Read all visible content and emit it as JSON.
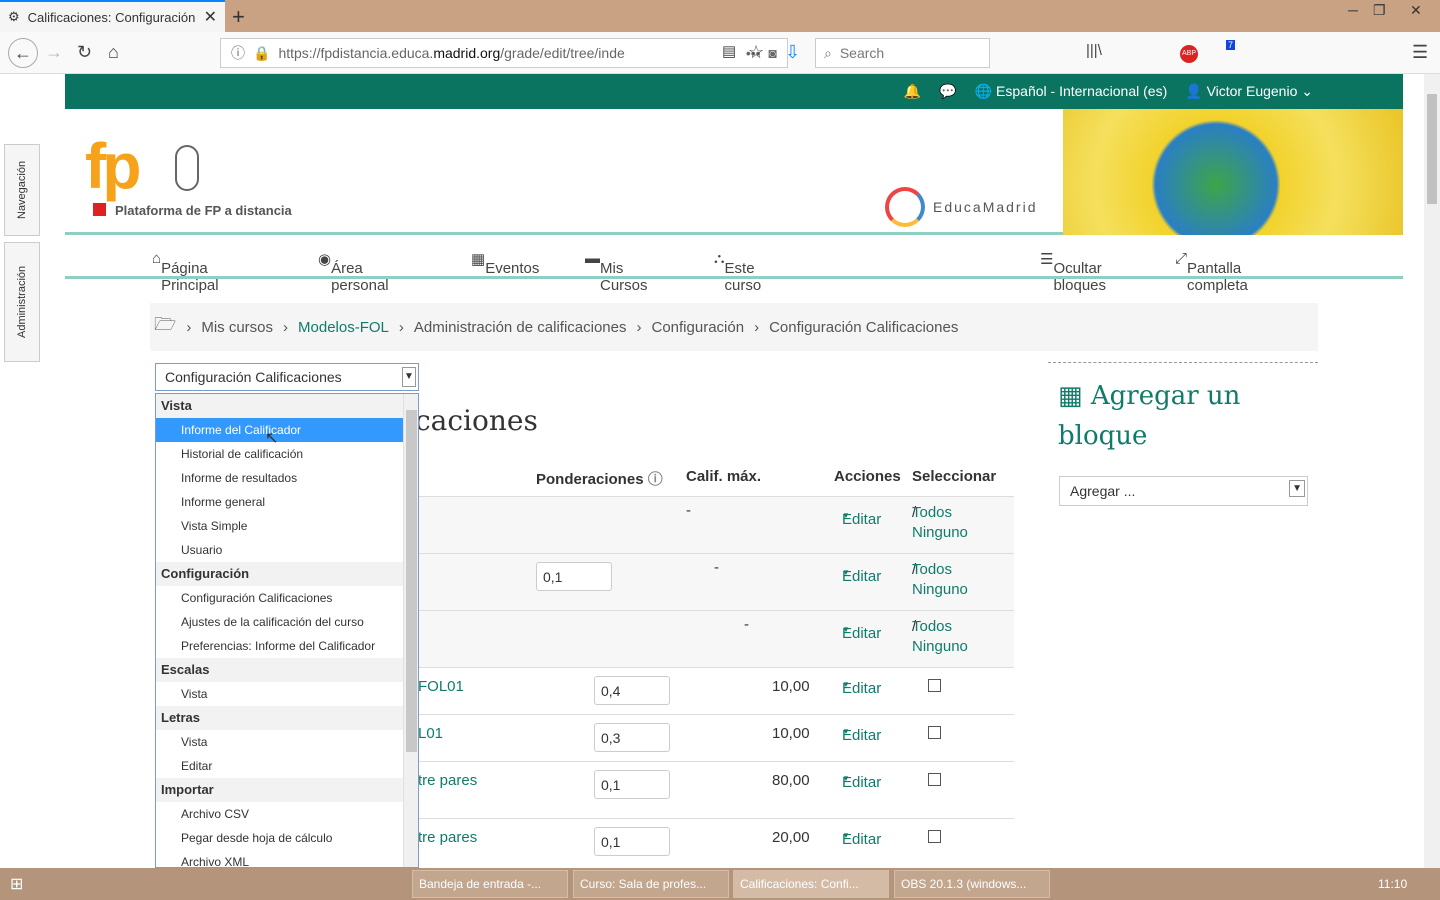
{
  "browser": {
    "tab_title": "Calificaciones: Configuración",
    "url_prefix": "https://fpdistancia.educa.",
    "url_domain": "madrid.org",
    "url_suffix": "/grade/edit/tree/inde",
    "search_placeholder": "Search",
    "ext_badge": "7"
  },
  "header": {
    "language": "Español - Internacional (es)",
    "user": "Victor Eugenio",
    "logo_text": "fp",
    "platform": "Plataforma de FP a distancia",
    "educamadrid": "EducaMadrid"
  },
  "nav": {
    "items": [
      "Página Principal",
      "Área personal",
      "Eventos",
      "Mis Cursos",
      "Este curso"
    ],
    "hide_blocks": "Ocultar bloques",
    "fullscreen": "Pantalla completa"
  },
  "breadcrumb": [
    "Mis cursos",
    "Modelos-FOL",
    "Administración de calificaciones",
    "Configuración",
    "Configuración Calificaciones"
  ],
  "side_tabs": [
    "Navegación",
    "Administración"
  ],
  "selector": {
    "value": "Configuración Calificaciones"
  },
  "dropdown": [
    {
      "group": "Vista",
      "items": [
        "Informe del Calificador",
        "Historial de calificación",
        "Informe de resultados",
        "Informe general",
        "Vista Simple",
        "Usuario"
      ]
    },
    {
      "group": "Configuración",
      "items": [
        "Configuración Calificaciones",
        "Ajustes de la calificación del curso",
        "Preferencias: Informe del Calificador"
      ]
    },
    {
      "group": "Escalas",
      "items": [
        "Vista"
      ]
    },
    {
      "group": "Letras",
      "items": [
        "Vista",
        "Editar"
      ]
    },
    {
      "group": "Importar",
      "items": [
        "Archivo CSV",
        "Pegar desde hoja de cálculo",
        "Archivo XML"
      ]
    }
  ],
  "main": {
    "title_partial": "caciones",
    "headers": {
      "weights": "Ponderaciones",
      "max": "Calif. máx.",
      "actions": "Acciones",
      "select": "Seleccionar"
    },
    "edit": "Editar",
    "all": "Todos",
    "none": "Ninguno",
    "rows": [
      {
        "name": "",
        "weight": "",
        "max": "-"
      },
      {
        "name": "",
        "weight": "0,1",
        "max": "-"
      },
      {
        "name": "",
        "weight": "",
        "max": "-"
      },
      {
        "name": "FOL01",
        "weight": "0,4",
        "max": "10,00"
      },
      {
        "name": "L01",
        "weight": "0,3",
        "max": "10,00"
      },
      {
        "name": "tre pares",
        "weight": "0,1",
        "max": "80,00"
      },
      {
        "name": "tre pares",
        "weight": "0,1",
        "max": "20,00"
      }
    ]
  },
  "block": {
    "title": "Agregar un bloque",
    "select": "Agregar ..."
  },
  "taskbar": {
    "tasks": [
      "Bandeja de entrada -...",
      "Curso: Sala de profes...",
      "Calificaciones: Confi...",
      "OBS 20.1.3 (windows..."
    ],
    "time": "11:10"
  }
}
